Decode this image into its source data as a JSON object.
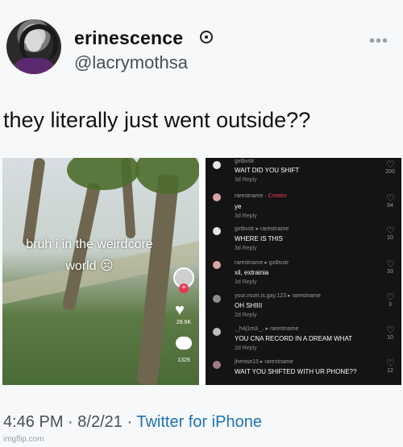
{
  "tweet": {
    "display_name": "erinescence",
    "handle": "@lacrymothsa",
    "text": "they literally just went outside??",
    "time": "4:46 PM",
    "date": "8/2/21",
    "separator": "·",
    "source": "Twitter for iPhone",
    "more_icon": "more-dots-icon",
    "verified_icon": "verified-badge-icon"
  },
  "video": {
    "caption_line1": "bruh i in the weirdcore",
    "caption_line2": "world ☹",
    "likes": "28.6K",
    "comments_count": "1329"
  },
  "comments": [
    {
      "user": "gxtbvstr",
      "tag": "",
      "text": "WAIT DID YOU SHIFT",
      "meta": "3d  Reply",
      "likes": "200"
    },
    {
      "user": "rarestname",
      "tag": "Creator",
      "text": "ye",
      "meta": "3d  Reply",
      "likes": "94"
    },
    {
      "user": "gxtbvstr ▸ rarestname",
      "tag": "",
      "text": "WHERE IS THIS",
      "meta": "3d  Reply",
      "likes": "10"
    },
    {
      "user": "rarestname ▸ gxtbvstr",
      "tag": "",
      "text": "xil, extrainia",
      "meta": "3d  Reply",
      "likes": "33"
    },
    {
      "user": "your.mum.is.gay.123 ▸ rarestname",
      "tag": "",
      "text": "OH SHIIII",
      "meta": "2d  Reply",
      "likes": "3"
    },
    {
      "user": "._h4j1m3._. ▸ rarestname",
      "tag": "",
      "text": "YOU CNA RECORD IN A DREAM WHAT",
      "meta": "2d  Reply",
      "likes": "10"
    },
    {
      "user": "jhenise15 ▸ rarestname",
      "tag": "",
      "text": "WAIT YOU SHIFTED WITH UR PHONE??",
      "meta": "2d  Reply",
      "likes": "12"
    }
  ],
  "watermark": "imgflip.com"
}
